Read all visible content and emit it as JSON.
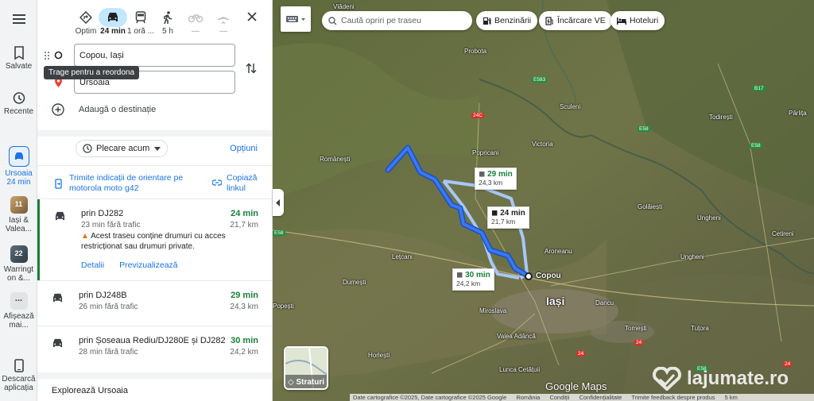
{
  "rail": {
    "menu_icon": "menu-icon",
    "saved": "Salvate",
    "recent": "Recente",
    "directions_line1": "Ursoaia",
    "directions_line2": "24 min",
    "recent1_line1": "Iași &",
    "recent1_line2": "Valea...",
    "recent1_badge": "11",
    "recent2_line1": "Warringt",
    "recent2_line2": "on &...",
    "recent2_badge": "22",
    "more_dots": "...",
    "more_line1": "Afișează",
    "more_line2": "mai...",
    "download_line1": "Descarcă",
    "download_line2": "aplicația"
  },
  "modes": [
    {
      "label": "Optim",
      "icon": "best-route-icon"
    },
    {
      "label": "24 min",
      "icon": "car-icon"
    },
    {
      "label": "1 oră ...",
      "icon": "transit-icon"
    },
    {
      "label": "5 h",
      "icon": "walk-icon"
    },
    {
      "label": "—",
      "icon": "bike-icon"
    },
    {
      "label": "—",
      "icon": "flight-icon"
    }
  ],
  "origin": "Copou, Iași",
  "destination": "Ursoaia",
  "tooltip": "Trage pentru a reordona",
  "add_destination": "Adaugă o destinație",
  "depart_now": "Plecare acum",
  "options": "Opțiuni",
  "send_line1": "Trimite indicații de orientare pe",
  "send_line2": "motorola moto g42",
  "copy_line1": "Copiază",
  "copy_line2": "linkul",
  "routes": [
    {
      "name": "prin DJ282",
      "sub": "23 min fără trafic",
      "time": "24 min",
      "dist": "21,7 km",
      "warning_line1": "Acest traseu conține drumuri cu acces",
      "warning_line2": "restricționat sau drumuri private.",
      "details": "Detalii",
      "preview": "Previzualizează"
    },
    {
      "name": "prin DJ248B",
      "sub": "26 min fără trafic",
      "time": "29 min",
      "dist": "24,3 km"
    },
    {
      "name": "prin Șoseaua Rediu/DJ280E și DJ282",
      "sub": "28 min fără trafic",
      "time": "30 min",
      "dist": "24,2 km"
    }
  ],
  "explore": "Explorează Ursoaia",
  "map": {
    "search_placeholder": "Caută opriri pe traseu",
    "chips": [
      "Benzinării",
      "Încărcare VE",
      "Hoteluri"
    ],
    "layers": "Straturi",
    "callouts": [
      {
        "time": "29 min",
        "dist": "24,3 km"
      },
      {
        "time": "24 min",
        "dist": "21,7 km"
      },
      {
        "time": "30 min",
        "dist": "24,2 km"
      }
    ],
    "origin_label": "Copou",
    "city": "Iași",
    "places": [
      "Vlădeni",
      "Probota",
      "Sculeni",
      "Todirești",
      "Pârlița",
      "Victoria",
      "Popricani",
      "Românești",
      "Golăiești",
      "Ungheni",
      "Cetireni",
      "Aroneanu",
      "Ungheni",
      "Lețcani",
      "Dumești",
      "Popești",
      "Dancu",
      "Miroslava",
      "Tomești",
      "Tuțora",
      "Valea Adâncă",
      "Horlești",
      "Lunca Cetățuii"
    ],
    "shields": [
      "E583",
      "B17",
      "E58",
      "E58",
      "24C",
      "24",
      "E58",
      "24",
      "24",
      "E58"
    ],
    "brand": "Google Maps",
    "footer": [
      "Date cartografice ©2025, Date cartografice ©2025 Google",
      "România",
      "Condiții",
      "Confidențialitate",
      "Trimite feedback despre produs",
      "5 km"
    ],
    "watermark": "lajumate.ro"
  },
  "colors": {
    "route_primary": "#3367d6",
    "route_alt": "#a8c7fa",
    "accent_green": "#188038",
    "link_blue": "#1a73e8"
  }
}
